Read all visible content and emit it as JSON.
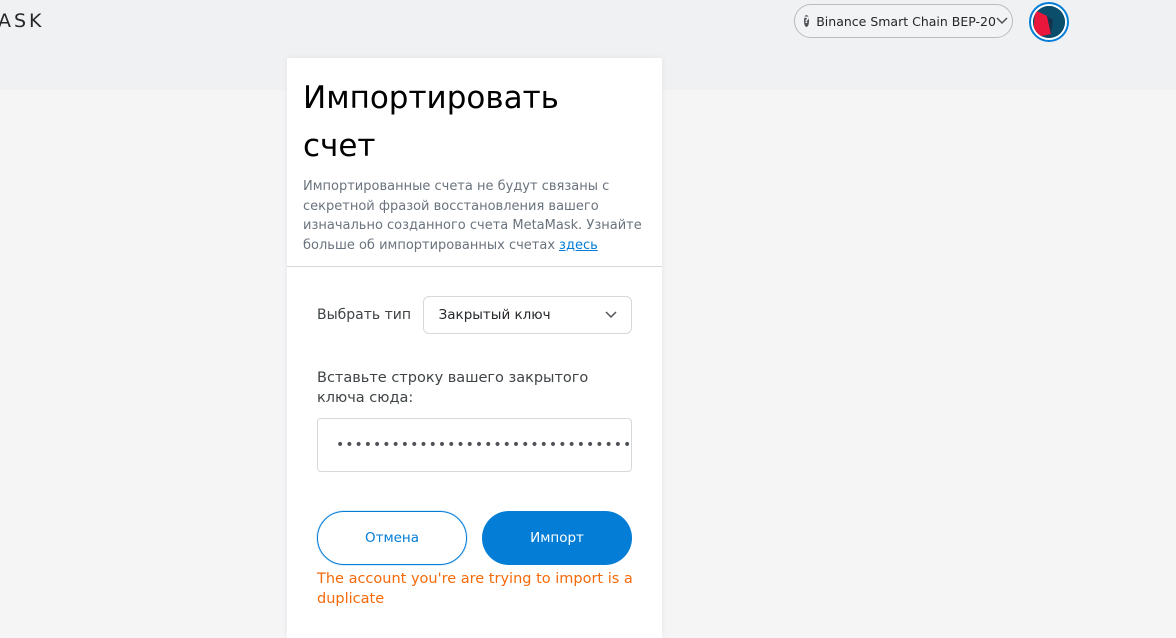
{
  "app": {
    "logo_text": "ASK"
  },
  "network": {
    "label": "Binance Smart Chain BEP-20",
    "icon": "question-icon",
    "icon_glyph": "?"
  },
  "account": {
    "avatar": "jazzicon-avatar"
  },
  "import": {
    "title": "Импортировать счет",
    "description": "Импортированные счета не будут связаны с секретной фразой восстановления вашего изначально созданного счета MetaMask. Узнайте больше об импортированных счетах",
    "learn_more_link": "здесь",
    "type_label": "Выбрать тип",
    "type_value": "Закрытый ключ",
    "paste_label": "Вставьте строку вашего закрытого ключа сюда:",
    "key_value": "••••••••••••••••••••••••••••••••••••••••",
    "cancel_label": "Отмена",
    "import_label": "Импорт",
    "error_text": "The account you're are trying to import is a duplicate"
  },
  "colors": {
    "accent": "#037dd6",
    "error": "#f66a0a",
    "avatar_bg": "#0b4e6b",
    "avatar_red": "#e8173b"
  }
}
